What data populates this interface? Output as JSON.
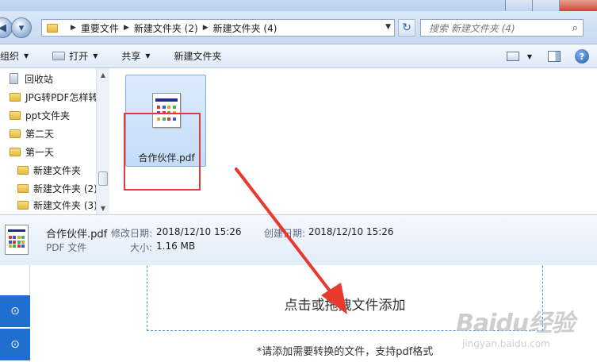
{
  "address": {
    "crumbs": [
      "重要文件",
      "新建文件夹 (2)",
      "新建文件夹 (4)"
    ]
  },
  "search": {
    "placeholder": "搜索 新建文件夹 (4)"
  },
  "toolbar": {
    "organize": "组织",
    "open": "打开",
    "share": "共享",
    "new_folder": "新建文件夹"
  },
  "nav": {
    "items": [
      "回收站",
      "JPG转PDF怎样转",
      "ppt文件夹",
      "第二天",
      "第一天",
      "新建文件夹",
      "新建文件夹 (2)",
      "新建文件夹 (3)"
    ]
  },
  "file": {
    "name": "合作伙伴.pdf"
  },
  "details": {
    "name": "合作伙伴.pdf",
    "type": "PDF 文件",
    "modified_label": "修改日期:",
    "modified_value": "2018/12/10 15:26",
    "created_label": "创建日期:",
    "created_value": "2018/12/10 15:26",
    "size_label": "大小:",
    "size_value": "1.16 MB"
  },
  "app": {
    "drop_text": "点击或拖拽文件添加",
    "hint_text": "*请添加需要转换的文件，支持pdf格式"
  },
  "watermark": {
    "brand": "Baidu经验",
    "url": "jingyan.baidu.com"
  },
  "colors": {
    "accent": "#1f6fd0",
    "highlight": "#e03c3c"
  }
}
